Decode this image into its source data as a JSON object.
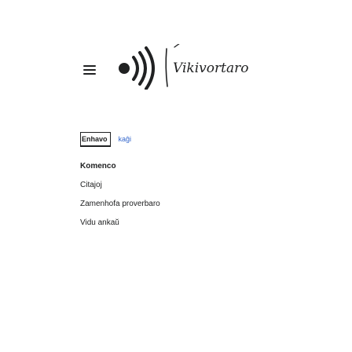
{
  "header": {
    "menu_icon": "hamburger-menu-icon",
    "logo_icon": "wikimedia-sound-waves-icon",
    "logo_wordmark": "Vikivortaro",
    "logo_color": "#202122"
  },
  "tabs": [
    {
      "label": "Enhavo",
      "selected": true
    },
    {
      "label": "kaĝi",
      "selected": false
    }
  ],
  "link_color": "#3366cc",
  "menu": {
    "items": [
      {
        "label": "Komenco"
      },
      {
        "label": "Citajoj"
      },
      {
        "label": "Zamenhofa proverbaro"
      },
      {
        "label": "Vidu ankaŭ"
      }
    ]
  }
}
